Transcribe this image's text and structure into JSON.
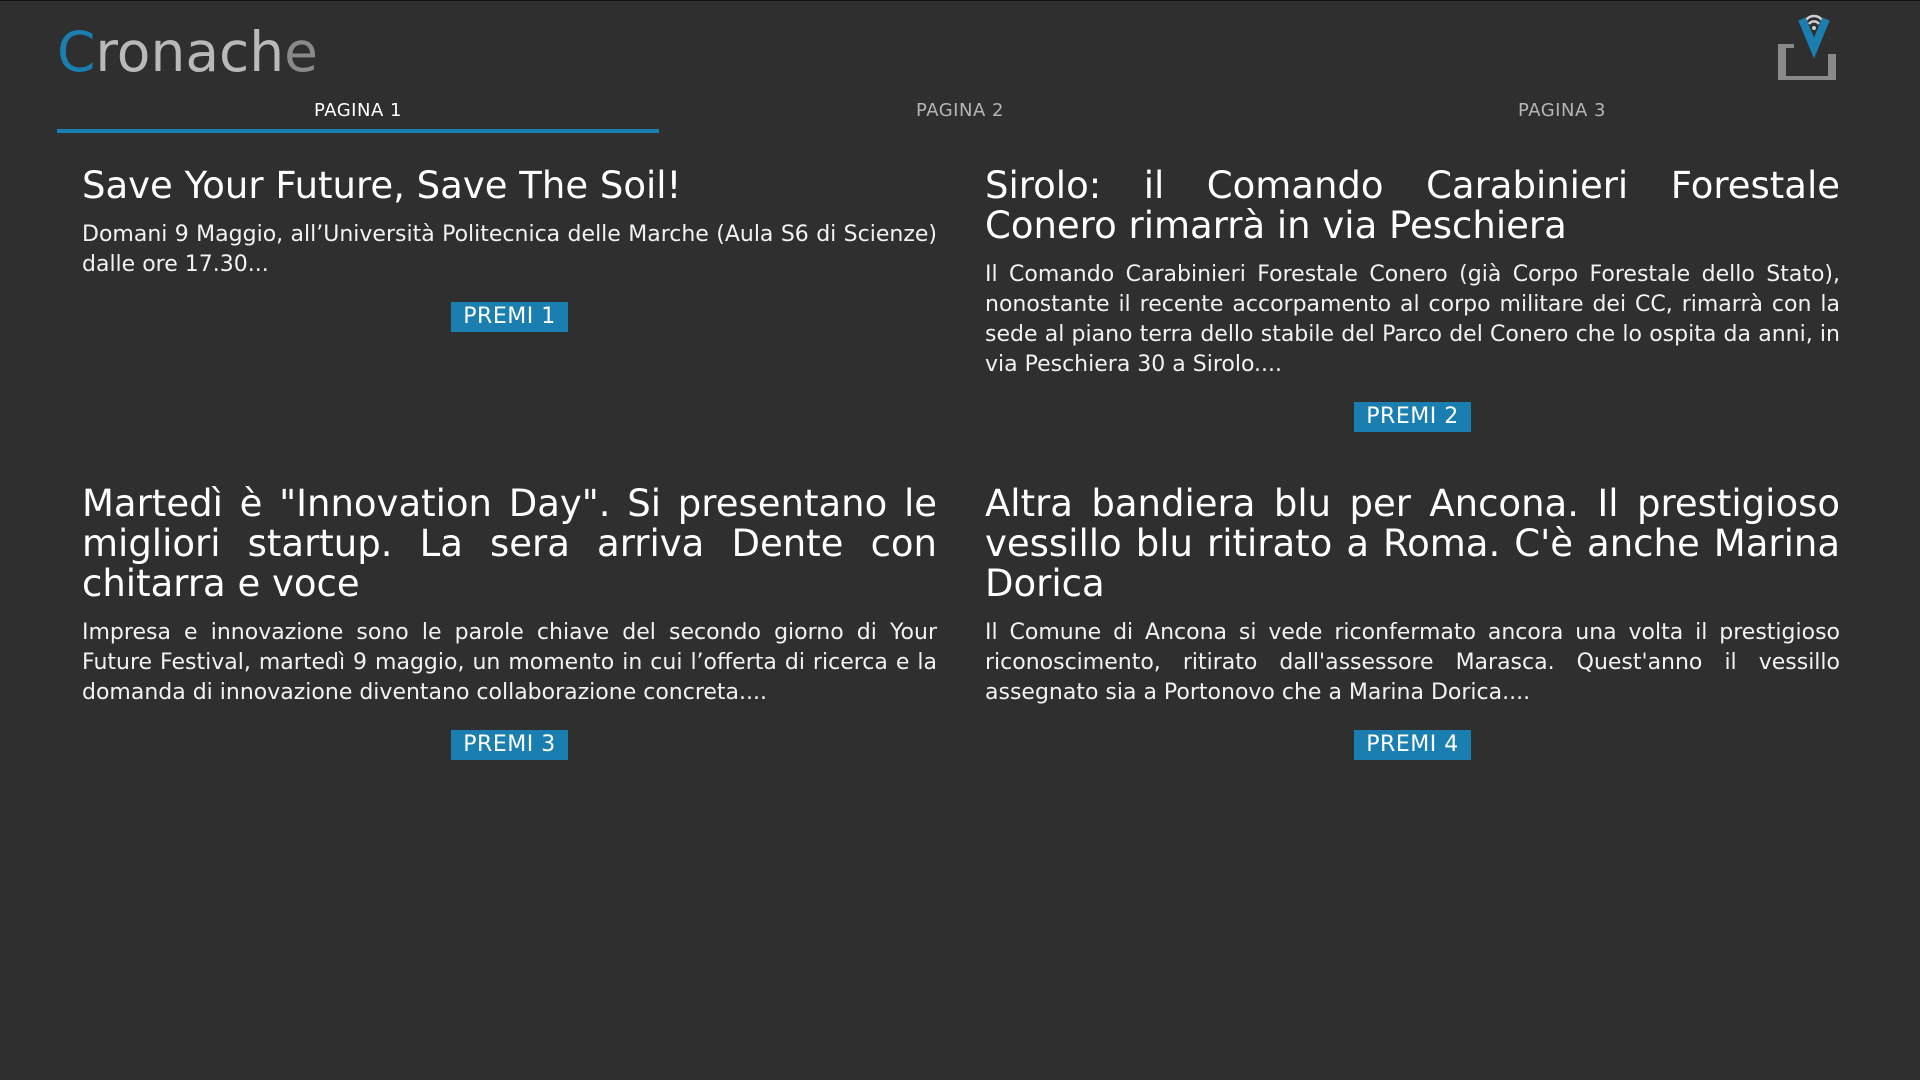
{
  "header": {
    "logo_first": "C",
    "logo_middle": "ronach",
    "logo_last": "e",
    "icon": "tv-antenna-icon"
  },
  "tabs": [
    {
      "label": "PAGINA 1",
      "active": true
    },
    {
      "label": "PAGINA 2",
      "active": false
    },
    {
      "label": "PAGINA 3",
      "active": false
    }
  ],
  "articles": [
    {
      "title": "Save Your Future, Save The Soil!",
      "summary": "Domani 9 Maggio, all’Università Politecnica delle Marche (Aula S6 di Scienze) dalle ore 17.30...",
      "button": "PREMI 1"
    },
    {
      "title": "Sirolo: il Comando Carabinieri Forestale Conero rimarrà in via Peschiera",
      "summary": "Il Comando Carabinieri Forestale Conero (già Corpo Forestale dello Stato), nonostante il recente accorpamento al corpo militare dei CC, rimarrà con la sede al piano terra dello stabile del Parco del Conero che lo ospita da anni, in via Peschiera 30 a Sirolo....",
      "button": "PREMI 2"
    },
    {
      "title": "Martedì è \"Innovation Day\". Si presentano le migliori startup. La sera arriva Dente con chitarra e voce",
      "summary": "Impresa e innovazione sono le parole chiave del secondo giorno di Your Future Festival, martedì 9 maggio, un momento in cui l’offerta di ricerca e la domanda di innovazione diventano collaborazione concreta....",
      "button": "PREMI 3"
    },
    {
      "title": "Altra bandiera blu per Ancona. Il prestigioso vessillo blu ritirato a Roma. C'è anche Marina Dorica",
      "summary": "Il Comune di Ancona si vede riconfermato ancora una volta il prestigioso riconoscimento, ritirato dall'assessore Marasca. Quest'anno il vessillo assegnato sia a Portonovo che a Marina Dorica....",
      "button": "PREMI 4"
    }
  ],
  "colors": {
    "background": "#2f2f2f",
    "accent": "#1a7fb0"
  }
}
